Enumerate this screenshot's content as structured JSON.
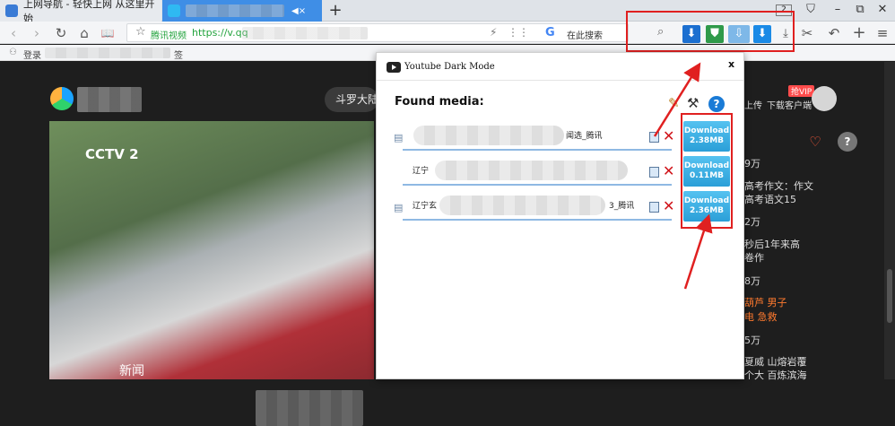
{
  "tabs": [
    {
      "label": "上网导航 - 轻快上网 从这里开始"
    },
    {
      "label": "",
      "audio": "◀×",
      "close": "×"
    }
  ],
  "new_tab": "+",
  "tab_count": "2",
  "window_controls": {
    "clothing": "⛉",
    "minimize": "–",
    "restore": "⧉",
    "close": "✕"
  },
  "toolbar": {
    "back": "‹",
    "forward": "›",
    "reload": "↻",
    "home": "⌂",
    "reader": "📖",
    "site_name": "腾讯视频",
    "url": "https://v.qq",
    "search_engine": "G",
    "search_placeholder": "在此搜索",
    "right_icons": {
      "cut": "✂",
      "undo": "↶",
      "add": "+",
      "menu": "≡"
    }
  },
  "extensions": [
    {
      "name": "download-manager",
      "color": "#1b6fd0"
    },
    {
      "name": "shield-download",
      "color": "#2f9a4a"
    },
    {
      "name": "video-downloader",
      "color": "#7eb8e8"
    },
    {
      "name": "arrow-download",
      "color": "#1a8ae6"
    },
    {
      "name": "download-tray",
      "color": "#555555"
    }
  ],
  "bookmarks": {
    "start": "登录",
    "end": "签"
  },
  "page": {
    "search_text": "斗罗大陆",
    "video_logo": "CCTV 2",
    "video_caption": "新闻",
    "upload": "上传",
    "client": "下载客户端",
    "vip": "抢VIP",
    "favorite": "♡",
    "help": "?",
    "side_items": [
      {
        "text": "9万",
        "orange": false
      },
      {
        "text": "高考作文：作文",
        "orange": false
      },
      {
        "text": "高考语文15",
        "orange": false
      },
      {
        "text": "2万",
        "orange": false
      },
      {
        "text": "秒后1年来高",
        "orange": false
      },
      {
        "text": "卷作",
        "orange": false
      },
      {
        "text": "8万",
        "orange": false
      },
      {
        "text": "葫芦 男子",
        "orange": true
      },
      {
        "text": "电 急救",
        "orange": true
      },
      {
        "text": "5万",
        "orange": false
      },
      {
        "text": "夏威 山熔岩覆",
        "orange": false
      },
      {
        "text": "个大 百炼滨海",
        "orange": false
      }
    ]
  },
  "popup": {
    "title": "Youtube Dark Mode",
    "close": "x",
    "found_media": "Found media:",
    "help": "?",
    "rows": [
      {
        "name_start": "",
        "name_end": "闻选_腾讯",
        "download_line1": "Download",
        "download_line2": "2.38MB"
      },
      {
        "name_start": "辽宁",
        "name_end": "",
        "download_line1": "Download",
        "download_line2": "0.11MB"
      },
      {
        "name_start": "辽宁玄",
        "name_end": "3_腾讯",
        "download_line1": "Download",
        "download_line2": "2.36MB"
      }
    ]
  }
}
